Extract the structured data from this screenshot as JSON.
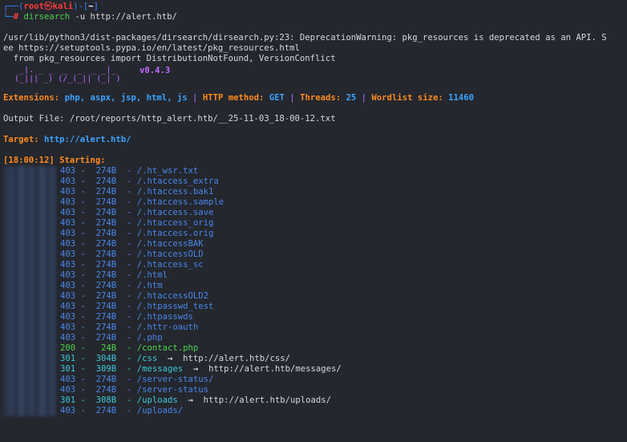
{
  "prompt": {
    "user": "root",
    "symbol": "㉿",
    "host": "kali",
    "dir": "~",
    "command": "dirsearch -u http://alert.htb/"
  },
  "warning": {
    "line1": "/usr/lib/python3/dist-packages/dirsearch/dirsearch.py:23: DeprecationWarning: pkg_resources is deprecated as an API. S",
    "line2": "ee https://setuptools.pypa.io/en/latest/pkg_resources.html",
    "line3": "  from pkg_resources import DistributionNotFound, VersionConflict"
  },
  "banner": {
    "art_top": "  _|. _ _  _  _  _ _|_",
    "art_bottom": " (_||| _) (/_(_|| (_| )",
    "version": "v0.4.3"
  },
  "config": {
    "extensions_label": "Extensions:",
    "extensions": "php, aspx, jsp, html, js",
    "method_label": "HTTP method:",
    "method": "GET",
    "threads_label": "Threads:",
    "threads": "25",
    "wordlist_label": "Wordlist size:",
    "wordlist": "11460",
    "sep": "|"
  },
  "output_file": "Output File: /root/reports/http_alert.htb/__25-11-03_18-00-12.txt",
  "target": {
    "label": "Target:",
    "url": "http://alert.htb/"
  },
  "start": {
    "time": "[18:00:12]",
    "label": "Starting:"
  },
  "results": [
    {
      "status": "403",
      "size": "274B",
      "path": "/.ht_wsr.txt",
      "redirect": ""
    },
    {
      "status": "403",
      "size": "274B",
      "path": "/.htaccess_extra",
      "redirect": ""
    },
    {
      "status": "403",
      "size": "274B",
      "path": "/.htaccess.bak1",
      "redirect": ""
    },
    {
      "status": "403",
      "size": "274B",
      "path": "/.htaccess.sample",
      "redirect": ""
    },
    {
      "status": "403",
      "size": "274B",
      "path": "/.htaccess.save",
      "redirect": ""
    },
    {
      "status": "403",
      "size": "274B",
      "path": "/.htaccess_orig",
      "redirect": ""
    },
    {
      "status": "403",
      "size": "274B",
      "path": "/.htaccess.orig",
      "redirect": ""
    },
    {
      "status": "403",
      "size": "274B",
      "path": "/.htaccessBAK",
      "redirect": ""
    },
    {
      "status": "403",
      "size": "274B",
      "path": "/.htaccessOLD",
      "redirect": ""
    },
    {
      "status": "403",
      "size": "274B",
      "path": "/.htaccess_sc",
      "redirect": ""
    },
    {
      "status": "403",
      "size": "274B",
      "path": "/.html",
      "redirect": ""
    },
    {
      "status": "403",
      "size": "274B",
      "path": "/.htm",
      "redirect": ""
    },
    {
      "status": "403",
      "size": "274B",
      "path": "/.htaccessOLD2",
      "redirect": ""
    },
    {
      "status": "403",
      "size": "274B",
      "path": "/.htpasswd_test",
      "redirect": ""
    },
    {
      "status": "403",
      "size": "274B",
      "path": "/.htpasswds",
      "redirect": ""
    },
    {
      "status": "403",
      "size": "274B",
      "path": "/.httr-oauth",
      "redirect": ""
    },
    {
      "status": "403",
      "size": "274B",
      "path": "/.php",
      "redirect": ""
    },
    {
      "status": "200",
      "size": " 24B",
      "path": "/contact.php",
      "redirect": ""
    },
    {
      "status": "301",
      "size": "304B",
      "path": "/css",
      "redirect": "http://alert.htb/css/"
    },
    {
      "status": "301",
      "size": "309B",
      "path": "/messages",
      "redirect": "http://alert.htb/messages/"
    },
    {
      "status": "403",
      "size": "274B",
      "path": "/server-status/",
      "redirect": ""
    },
    {
      "status": "403",
      "size": "274B",
      "path": "/server-status",
      "redirect": ""
    },
    {
      "status": "301",
      "size": "308B",
      "path": "/uploads",
      "redirect": "http://alert.htb/uploads/"
    },
    {
      "status": "403",
      "size": "274B",
      "path": "/uploads/",
      "redirect": ""
    }
  ],
  "colors": {
    "background": "#24272e",
    "prompt": "#3a80ff",
    "root": "#ff3a3a",
    "orange": "#ff8a1f",
    "cyan": "#3ba3ff",
    "status_403": "#4a86e8",
    "status_200": "#4fd14f",
    "status_301": "#3fc7d6"
  }
}
